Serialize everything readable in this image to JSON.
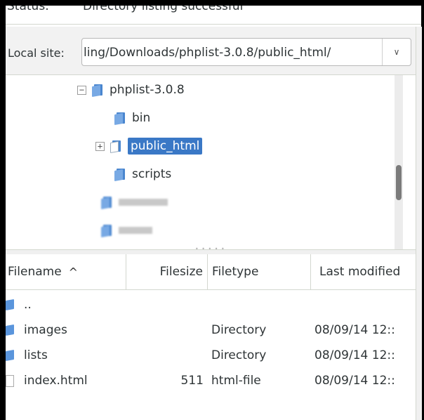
{
  "status": {
    "label": "Status:",
    "text": "Directory listing successful"
  },
  "local_site": {
    "label": "Local site:",
    "path": "ling/Downloads/phplist-3.0.8/public_html/"
  },
  "tree": {
    "root": {
      "label": "phplist-3.0.8",
      "expander": "−"
    },
    "children": [
      {
        "label": "bin"
      },
      {
        "label": "public_html",
        "expander": "+"
      },
      {
        "label": "scripts"
      }
    ]
  },
  "list": {
    "columns": {
      "filename": "Filename",
      "filesize": "Filesize",
      "filetype": "Filetype",
      "last_modified": "Last modified"
    },
    "sort_indicator": "^",
    "rows": [
      {
        "name": "..",
        "size": "",
        "type": "",
        "modified": ""
      },
      {
        "name": "images",
        "size": "",
        "type": "Directory",
        "modified": "08/09/14 12::"
      },
      {
        "name": "lists",
        "size": "",
        "type": "Directory",
        "modified": "08/09/14 12::"
      },
      {
        "name": "index.html",
        "size": "511",
        "type": "html-file",
        "modified": "08/09/14 12::"
      }
    ]
  },
  "colors": {
    "selection": "#3a78c6",
    "folder": "#4a86cf"
  },
  "icons": [
    "folder-icon",
    "file-icon",
    "chevron-down-icon",
    "sort-up-icon"
  ]
}
